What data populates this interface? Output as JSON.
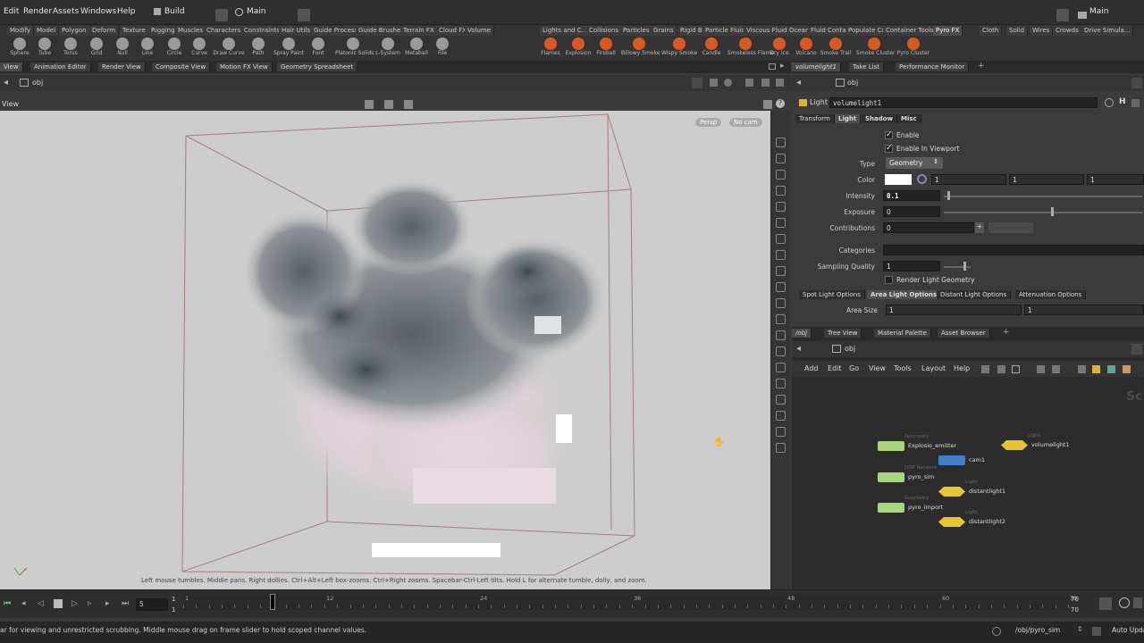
{
  "menubar": {
    "items": [
      "Edit",
      "Render",
      "Assets",
      "Windows",
      "Help"
    ],
    "desktop": "Build",
    "context": "Main",
    "right_desktop": "Main"
  },
  "shelf": {
    "left_tabs": [
      "Modify",
      "Model",
      "Polygon",
      "Deform",
      "Texture",
      "Rigging",
      "Muscles",
      "Characters",
      "Constraints",
      "Hair Utils",
      "Guide Process",
      "Guide Brushes",
      "Terrain FX",
      "Cloud FX",
      "Volume"
    ],
    "right_tabs": [
      "Lights and C...",
      "Collisions",
      "Particles",
      "Grains",
      "Rigid Bodies",
      "Particle Fluids",
      "Viscous Fluids",
      "Oceans",
      "Fluid Contai...",
      "Populate Con...",
      "Container Tools",
      "Pyro FX",
      "Cloth",
      "Solid",
      "Wires",
      "Crowds",
      "Drive Simula..."
    ],
    "active_right_tab": "Pyro FX",
    "left_tools": [
      "Sphere",
      "Tube",
      "Torus",
      "Grid",
      "Null",
      "Line",
      "Circle",
      "Curve",
      "Draw Curve",
      "Path",
      "Spray Paint",
      "Font",
      "Platonic Solids",
      "L-System",
      "Metaball",
      "File"
    ],
    "right_tools": [
      "Flames",
      "Explosion",
      "Fireball",
      "Billowy Smoke",
      "Wispy Smoke",
      "Candle",
      "Smokeless Flame",
      "Dry Ice",
      "Volcano",
      "Smoke Trail",
      "Smoke Cluster",
      "Pyro Cluster"
    ]
  },
  "viewer": {
    "tabs": [
      "View",
      "Animation Editor",
      "Render View",
      "Composite View",
      "Motion FX View",
      "Geometry Spreadsheet"
    ],
    "path": "obj",
    "header": "View",
    "persp": "Persp",
    "cam": "No cam",
    "hint": "Left mouse tumbles. Middle pans. Right dollies. Ctrl+Alt+Left box-zooms. Ctrl+Right zooms. Spacebar-Ctrl-Left tilts. Hold L for alternate tumble, dolly, and zoom."
  },
  "params": {
    "tabs": [
      "volumelight1",
      "Take List",
      "Performance Monitor"
    ],
    "path": "obj",
    "node_type": "Light",
    "node_name": "volumelight1",
    "folder_tabs": [
      "Transform",
      "Light",
      "Shadow",
      "Misc"
    ],
    "active_folder": "Light",
    "enable_label": "Enable",
    "enable_viewport_label": "Enable In Viewport",
    "type_label": "Type",
    "type_value": "Geometry",
    "color_label": "Color",
    "color_values": [
      "1",
      "1",
      "1"
    ],
    "intensity_label": "Intensity",
    "intensity_value": "0.1",
    "intensity_fraction": 0.1,
    "exposure_label": "Exposure",
    "exposure_value": "0",
    "contributions_label": "Contributions",
    "contributions_value": "0",
    "categories_label": "Categories",
    "sampling_label": "Sampling Quality",
    "sampling_value": "1",
    "render_geo_label": "Render Light Geometry",
    "option_tabs": [
      "Spot Light Options",
      "Area Light Options",
      "Distant Light Options",
      "Attenuation Options"
    ],
    "active_option_tab": "Area Light Options",
    "area_size_label": "Area Size",
    "area_size_values": [
      "1",
      "1"
    ]
  },
  "network": {
    "tabs": [
      "/obj",
      "Tree View",
      "Material Palette",
      "Asset Browser"
    ],
    "path": "obj",
    "menu": [
      "Add",
      "Edit",
      "Go",
      "View",
      "Tools",
      "Layout",
      "Help"
    ],
    "corner_text": "Sc",
    "nodes": [
      {
        "type": "Geometry",
        "name": "Explosio_emitter",
        "color": "#a9d67b"
      },
      {
        "type": "Camera",
        "name": "cam1",
        "color": "#3f7fc7"
      },
      {
        "type": "DOP Network",
        "name": "pyro_sim",
        "color": "#a9d67b"
      },
      {
        "type": "Geometry",
        "name": "pyro_import",
        "color": "#a9d67b"
      },
      {
        "type": "Light",
        "name": "volumelight1",
        "color": "#e8c42f"
      },
      {
        "type": "Light",
        "name": "distantlight1",
        "color": "#e8c42f"
      },
      {
        "type": "Light",
        "name": "distantlight2",
        "color": "#e8c42f"
      }
    ]
  },
  "timeline": {
    "current_frame": "5",
    "start": "1",
    "end_top": "70",
    "end_bottom": "70",
    "ticks": [
      "1",
      "12",
      "24",
      "36",
      "48",
      "60",
      "70"
    ],
    "playhead_frame": 8
  },
  "status": {
    "message": "ar for viewing and unrestricted scrubbing. Middle mouse drag on frame slider to hold scoped channel values.",
    "path": "/obj/pyro_sim",
    "update": "Auto Upda"
  },
  "colors": {
    "accent_orange": "#e0781e",
    "light_yellow": "#e8c42f",
    "geo_green": "#a9d67b",
    "camera_blue": "#3f7fc7"
  }
}
